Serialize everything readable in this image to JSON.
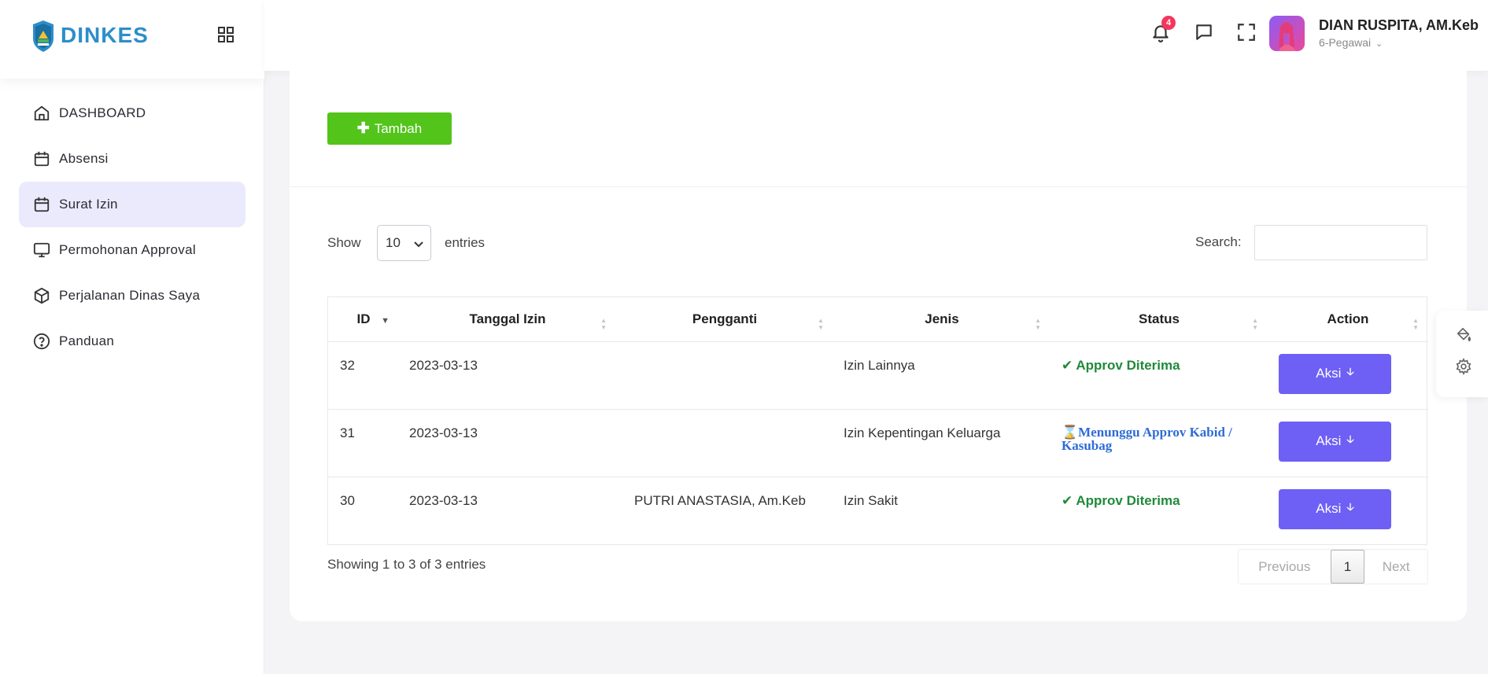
{
  "brand": {
    "name": "DINKES"
  },
  "sidebar": {
    "items": [
      {
        "label": "DASHBOARD",
        "icon": "home-icon"
      },
      {
        "label": "Absensi",
        "icon": "calendar-icon"
      },
      {
        "label": "Surat Izin",
        "icon": "calendar-icon",
        "active": true
      },
      {
        "label": "Permohonan Approval",
        "icon": "monitor-icon"
      },
      {
        "label": "Perjalanan Dinas Saya",
        "icon": "box-icon"
      },
      {
        "label": "Panduan",
        "icon": "help-circle-icon"
      }
    ]
  },
  "header": {
    "notification_count": "4",
    "user": {
      "name": "DIAN RUSPITA, AM.Keb",
      "role": "6-Pegawai"
    }
  },
  "toolbar": {
    "add_label": "Tambah"
  },
  "table_controls": {
    "show_label": "Show",
    "page_length": "10",
    "entries_label": "entries",
    "search_label": "Search:",
    "search_value": ""
  },
  "table": {
    "columns": [
      "ID",
      "Tanggal Izin",
      "Pengganti",
      "Jenis",
      "Status",
      "Action"
    ],
    "rows": [
      {
        "id": "32",
        "tanggal": "2023-03-13",
        "pengganti": "",
        "jenis": "Izin Lainnya",
        "status": "Approv Diterima",
        "status_type": "approved",
        "action": "Aksi"
      },
      {
        "id": "31",
        "tanggal": "2023-03-13",
        "pengganti": "",
        "jenis": "Izin Kepentingan Keluarga",
        "status": "Menunggu Approv Kabid / Kasubag",
        "status_type": "waiting",
        "action": "Aksi"
      },
      {
        "id": "30",
        "tanggal": "2023-03-13",
        "pengganti": "PUTRI ANASTASIA, Am.Keb",
        "jenis": "Izin Sakit",
        "status": "Approv Diterima",
        "status_type": "approved",
        "action": "Aksi"
      }
    ]
  },
  "footer": {
    "info": "Showing 1 to 3 of 3 entries",
    "pagination": {
      "previous": "Previous",
      "current": "1",
      "next": "Next"
    }
  },
  "colors": {
    "brand": "#2c8ec9",
    "add_button": "#52c41a",
    "action_button": "#6e5ff5",
    "status_approved": "#1f8a3a",
    "status_waiting": "#2f6bd6",
    "active_menu_bg": "#ebeafc",
    "badge": "#f5365c"
  }
}
